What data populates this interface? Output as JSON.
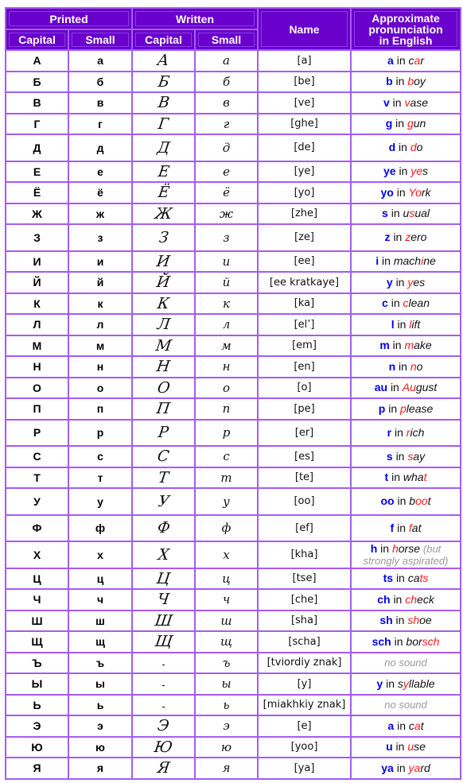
{
  "header": {
    "printed": "Printed",
    "written": "Written",
    "name": "Name",
    "pronunciation_lines": [
      "Approximate",
      "pronunciation",
      "in English"
    ],
    "capital": "Capital",
    "small": "Small"
  },
  "colors": {
    "header_bg": "#6a00cc",
    "border": "#a45cf2",
    "sound": "#0000ee",
    "highlight": "#ff1a1a",
    "note": "#9a9a9a"
  },
  "rows": [
    {
      "cap": "А",
      "small": "а",
      "wcap": "А",
      "wsmall": "а",
      "name": "[a]",
      "sound": "a",
      "word": [
        [
          "c",
          0
        ],
        [
          "a",
          1
        ],
        [
          "r",
          0
        ]
      ]
    },
    {
      "cap": "Б",
      "small": "б",
      "wcap": "Б",
      "wsmall": "б",
      "name": "[be]",
      "sound": "b",
      "word": [
        [
          "b",
          1
        ],
        [
          "oy",
          0
        ]
      ]
    },
    {
      "cap": "В",
      "small": "в",
      "wcap": "В",
      "wsmall": "в",
      "name": "[ve]",
      "sound": "v",
      "word": [
        [
          "v",
          1
        ],
        [
          "ase",
          0
        ]
      ]
    },
    {
      "cap": "Г",
      "small": "г",
      "wcap": "Г",
      "wsmall": "г",
      "name": "[ghe]",
      "sound": "g",
      "word": [
        [
          "g",
          1
        ],
        [
          "un",
          0
        ]
      ]
    },
    {
      "cap": "Д",
      "small": "д",
      "wcap": "Д",
      "wsmall": "д",
      "name": "[de]",
      "sound": "d",
      "word": [
        [
          "d",
          1
        ],
        [
          "o",
          0
        ]
      ],
      "tall": true
    },
    {
      "cap": "Е",
      "small": "е",
      "wcap": "Е",
      "wsmall": "е",
      "name": "[ye]",
      "sound": "ye",
      "word": [
        [
          "ye",
          1
        ],
        [
          "s",
          0
        ]
      ]
    },
    {
      "cap": "Ё",
      "small": "ё",
      "wcap": "Ё",
      "wsmall": "ё",
      "name": "[yo]",
      "sound": "yo",
      "word": [
        [
          "Yo",
          1
        ],
        [
          "rk",
          0
        ]
      ]
    },
    {
      "cap": "Ж",
      "small": "ж",
      "wcap": "Ж",
      "wsmall": "ж",
      "name": "[zhe]",
      "sound": "s",
      "word": [
        [
          "u",
          0
        ],
        [
          "s",
          1
        ],
        [
          "ual",
          0
        ]
      ]
    },
    {
      "cap": "З",
      "small": "з",
      "wcap": "З",
      "wsmall": "з",
      "name": "[ze]",
      "sound": "z",
      "word": [
        [
          "z",
          1
        ],
        [
          "ero",
          0
        ]
      ],
      "tall": true
    },
    {
      "cap": "И",
      "small": "и",
      "wcap": "И",
      "wsmall": "и",
      "name": "[ee]",
      "sound": "i",
      "word": [
        [
          "mach",
          0
        ],
        [
          "i",
          1
        ],
        [
          "ne",
          0
        ]
      ]
    },
    {
      "cap": "Й",
      "small": "й",
      "wcap": "Й",
      "wsmall": "й",
      "name": "[ee kratkaye]",
      "sound": "y",
      "word": [
        [
          "y",
          1
        ],
        [
          "es",
          0
        ]
      ]
    },
    {
      "cap": "К",
      "small": "к",
      "wcap": "К",
      "wsmall": "к",
      "name": "[ka]",
      "sound": "c",
      "word": [
        [
          "c",
          1
        ],
        [
          "lean",
          0
        ]
      ]
    },
    {
      "cap": "Л",
      "small": "л",
      "wcap": "Л",
      "wsmall": "л",
      "name": "[el’]",
      "sound": "l",
      "word": [
        [
          "l",
          1
        ],
        [
          "ift",
          0
        ]
      ]
    },
    {
      "cap": "М",
      "small": "м",
      "wcap": "М",
      "wsmall": "м",
      "name": "[em]",
      "sound": "m",
      "word": [
        [
          "m",
          1
        ],
        [
          "ake",
          0
        ]
      ]
    },
    {
      "cap": "Н",
      "small": "н",
      "wcap": "Н",
      "wsmall": "н",
      "name": "[en]",
      "sound": "n",
      "word": [
        [
          "n",
          1
        ],
        [
          "o",
          0
        ]
      ]
    },
    {
      "cap": "О",
      "small": "о",
      "wcap": "О",
      "wsmall": "о",
      "name": "[o]",
      "sound": "au",
      "word": [
        [
          "Au",
          1
        ],
        [
          "gust",
          0
        ]
      ]
    },
    {
      "cap": "П",
      "small": "п",
      "wcap": "П",
      "wsmall": "п",
      "name": "[pe]",
      "sound": "p",
      "word": [
        [
          "p",
          1
        ],
        [
          "lease",
          0
        ]
      ]
    },
    {
      "cap": "Р",
      "small": "р",
      "wcap": "Р",
      "wsmall": "р",
      "name": "[er]",
      "sound": "r",
      "word": [
        [
          "r",
          1
        ],
        [
          "ich",
          0
        ]
      ],
      "tall": true
    },
    {
      "cap": "С",
      "small": "с",
      "wcap": "С",
      "wsmall": "с",
      "name": "[es]",
      "sound": "s",
      "word": [
        [
          "s",
          1
        ],
        [
          "ay",
          0
        ]
      ]
    },
    {
      "cap": "Т",
      "small": "т",
      "wcap": "Т",
      "wsmall": "т",
      "name": "[te]",
      "sound": "t",
      "word": [
        [
          "wha",
          0
        ],
        [
          "t",
          1
        ]
      ]
    },
    {
      "cap": "У",
      "small": "у",
      "wcap": "У",
      "wsmall": "у",
      "name": "[oo]",
      "sound": "oo",
      "word": [
        [
          "b",
          0
        ],
        [
          "oo",
          1
        ],
        [
          "t",
          0
        ]
      ],
      "tall": true
    },
    {
      "cap": "Ф",
      "small": "ф",
      "wcap": "Ф",
      "wsmall": "ф",
      "name": "[ef]",
      "sound": "f",
      "word": [
        [
          "f",
          1
        ],
        [
          "at",
          0
        ]
      ],
      "tall": true
    },
    {
      "cap": "Х",
      "small": "х",
      "wcap": "Х",
      "wsmall": "х",
      "name": "[kha]",
      "sound": "h",
      "word": [
        [
          "h",
          1
        ],
        [
          "orse",
          0
        ]
      ],
      "note": "(but strongly aspirated)",
      "tall": true
    },
    {
      "cap": "Ц",
      "small": "ц",
      "wcap": "Ц",
      "wsmall": "ц",
      "name": "[tse]",
      "sound": "ts",
      "word": [
        [
          "ca",
          0
        ],
        [
          "ts",
          1
        ]
      ]
    },
    {
      "cap": "Ч",
      "small": "ч",
      "wcap": "Ч",
      "wsmall": "ч",
      "name": "[che]",
      "sound": "ch",
      "word": [
        [
          "ch",
          1
        ],
        [
          "eck",
          0
        ]
      ]
    },
    {
      "cap": "Ш",
      "small": "ш",
      "wcap": "Ш",
      "wsmall": "ш",
      "name": "[sha]",
      "sound": "sh",
      "word": [
        [
          "sh",
          1
        ],
        [
          "oe",
          0
        ]
      ]
    },
    {
      "cap": "Щ",
      "small": "щ",
      "wcap": "Щ",
      "wsmall": "щ",
      "name": "[scha]",
      "sound": "sch",
      "word": [
        [
          "bor",
          0
        ],
        [
          "sch",
          1
        ]
      ]
    },
    {
      "cap": "Ъ",
      "small": "ъ",
      "wcap": "-",
      "wsmall": "ъ",
      "name": "[tviordiy znak]",
      "nosound": "no sound"
    },
    {
      "cap": "Ы",
      "small": "ы",
      "wcap": "-",
      "wsmall": "ы",
      "name": "[y]",
      "sound": "y",
      "word": [
        [
          "s",
          0
        ],
        [
          "y",
          1
        ],
        [
          "llable",
          0
        ]
      ]
    },
    {
      "cap": "Ь",
      "small": "ь",
      "wcap": "-",
      "wsmall": "ь",
      "name": "[miakhkiy znak]",
      "nosound": "no sound"
    },
    {
      "cap": "Э",
      "small": "э",
      "wcap": "Э",
      "wsmall": "э",
      "name": "[e]",
      "sound": "a",
      "word": [
        [
          "c",
          0
        ],
        [
          "a",
          1
        ],
        [
          "t",
          0
        ]
      ]
    },
    {
      "cap": "Ю",
      "small": "ю",
      "wcap": "Ю",
      "wsmall": "ю",
      "name": "[yoo]",
      "sound": "u",
      "word": [
        [
          "u",
          1
        ],
        [
          "se",
          0
        ]
      ]
    },
    {
      "cap": "Я",
      "small": "я",
      "wcap": "Я",
      "wsmall": "я",
      "name": "[ya]",
      "sound": "ya",
      "word": [
        [
          "ya",
          1
        ],
        [
          "rd",
          0
        ]
      ]
    }
  ],
  "connector": "in"
}
